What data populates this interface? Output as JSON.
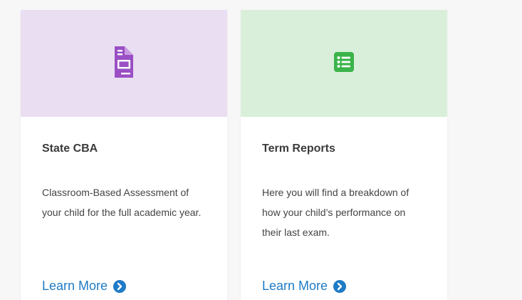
{
  "cards": [
    {
      "icon": "document-icon",
      "icon_color": "#9a4fc4",
      "hero_color": "#eadef2",
      "title": "State CBA",
      "description": "Classroom-Based Assessment of your child for the full academic year.",
      "link_label": "Learn More"
    },
    {
      "icon": "list-icon",
      "icon_color": "#3bb44a",
      "hero_color": "#d9efda",
      "title": "Term Reports",
      "description": "Here you will find a breakdown of how your child’s performance on their last exam.",
      "link_label": "Learn More"
    }
  ],
  "link_color": "#1f7bc6"
}
